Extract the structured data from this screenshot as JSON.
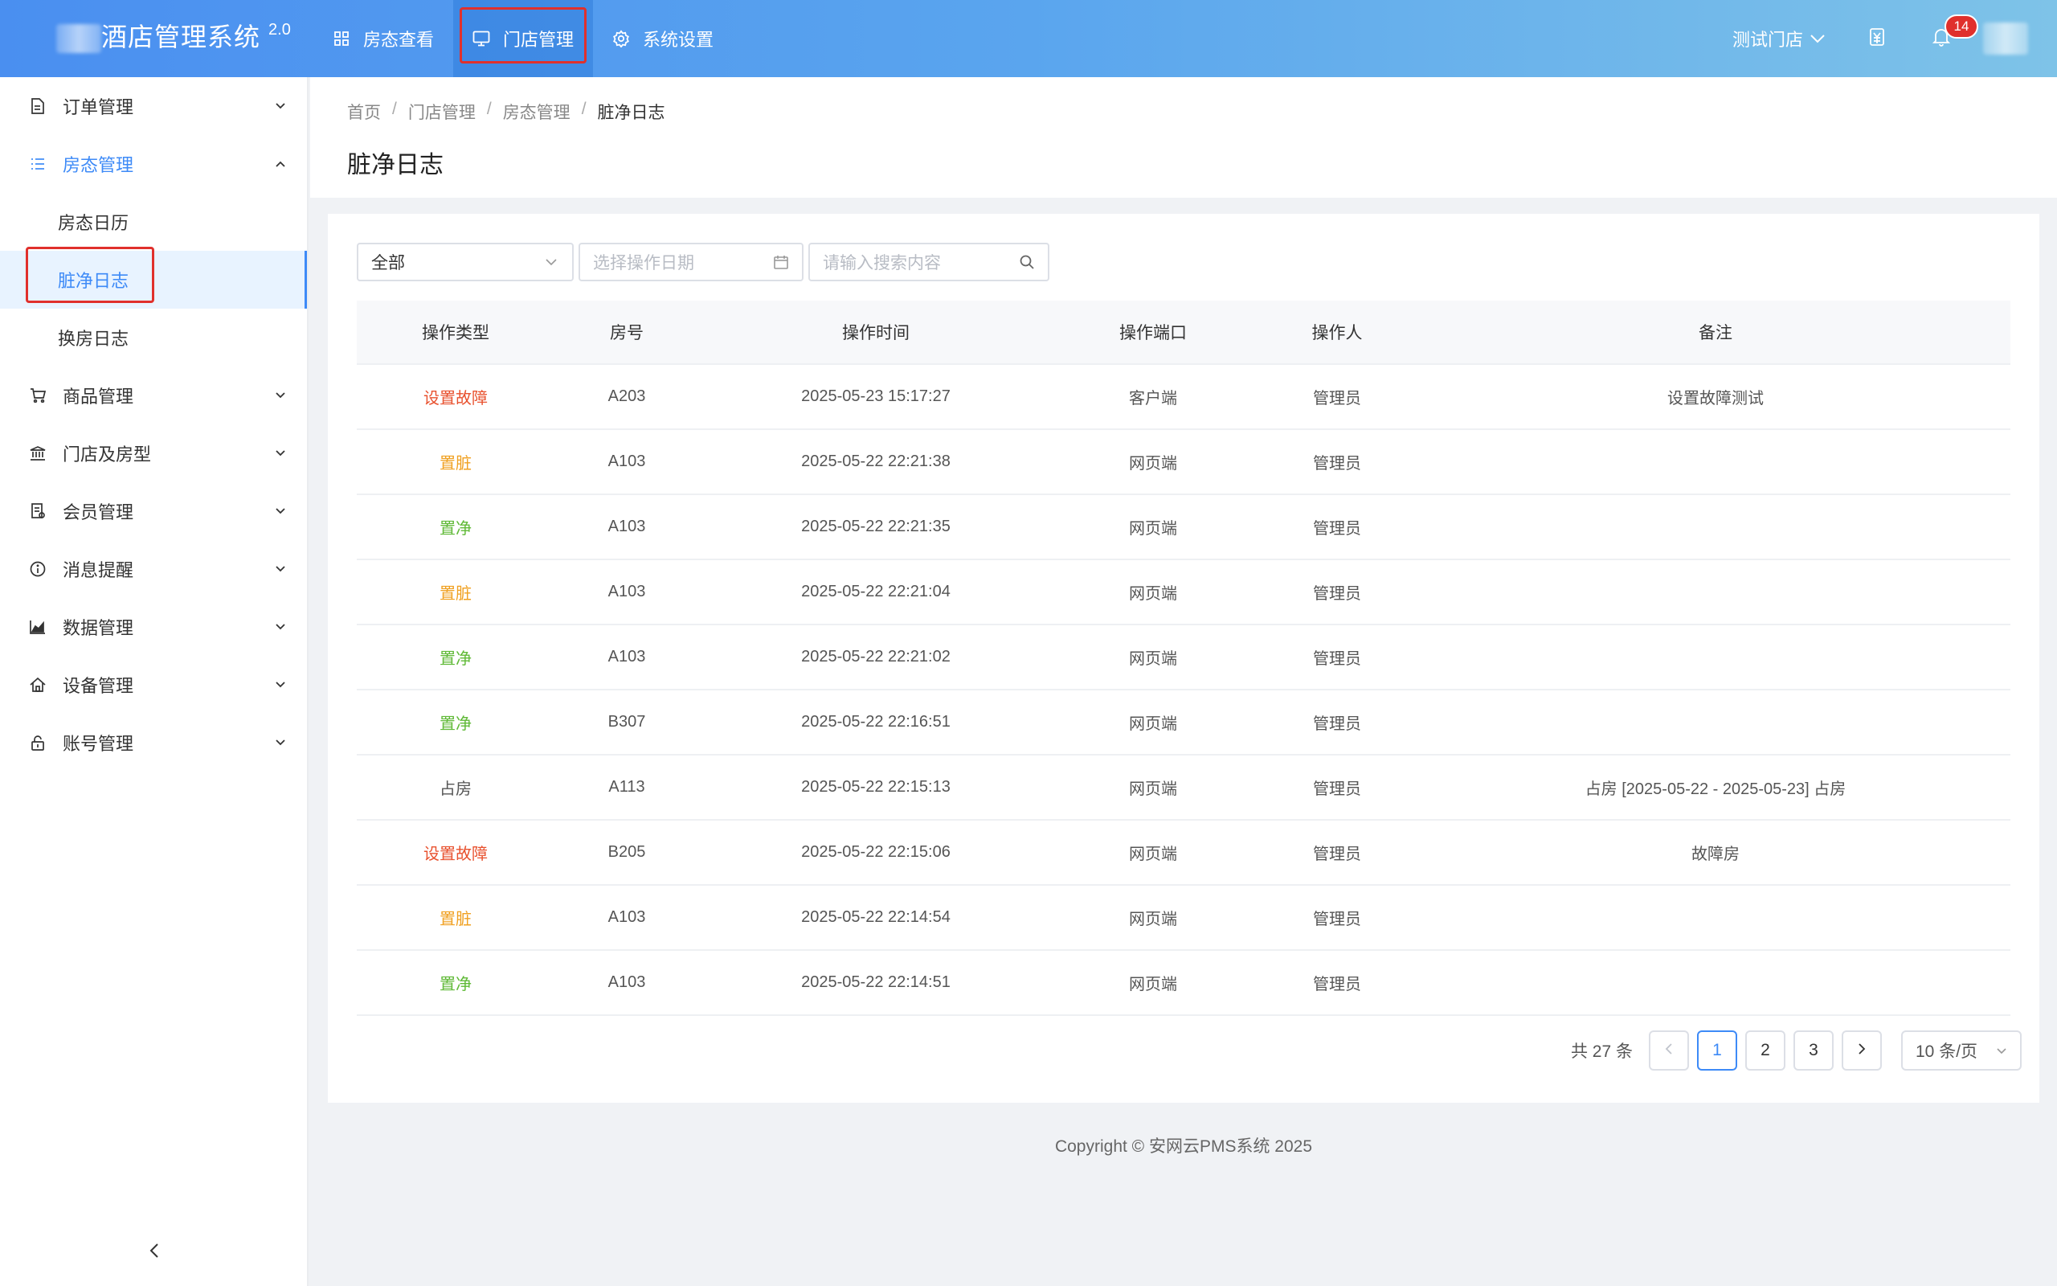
{
  "app": {
    "title": "酒店管理系统",
    "version": "2.0"
  },
  "topnav": [
    {
      "label": "房态查看",
      "icon": "grid-icon"
    },
    {
      "label": "门店管理",
      "icon": "monitor-icon",
      "active": true
    },
    {
      "label": "系统设置",
      "icon": "gear-icon"
    }
  ],
  "header": {
    "store": "测试门店",
    "notifications": "14"
  },
  "sidebar": {
    "items": [
      {
        "label": "订单管理",
        "icon": "document-icon"
      },
      {
        "label": "房态管理",
        "icon": "list-icon",
        "open": true
      },
      {
        "label": "商品管理",
        "icon": "cart-icon"
      },
      {
        "label": "门店及房型",
        "icon": "bank-icon"
      },
      {
        "label": "会员管理",
        "icon": "member-card-icon"
      },
      {
        "label": "消息提醒",
        "icon": "info-icon"
      },
      {
        "label": "数据管理",
        "icon": "area-chart-icon"
      },
      {
        "label": "设备管理",
        "icon": "home-icon"
      },
      {
        "label": "账号管理",
        "icon": "lock-icon"
      }
    ],
    "sub_items": [
      "房态日历",
      "脏净日志",
      "换房日志"
    ]
  },
  "breadcrumb": [
    "首页",
    "门店管理",
    "房态管理",
    "脏净日志"
  ],
  "page_title": "脏净日志",
  "filters": {
    "type_value": "全部",
    "date_placeholder": "选择操作日期",
    "search_placeholder": "请输入搜索内容"
  },
  "table": {
    "headers": [
      "操作类型",
      "房号",
      "操作时间",
      "操作端口",
      "操作人",
      "备注"
    ],
    "rows": [
      {
        "type": "设置故障",
        "room": "A203",
        "time": "2025-05-23 15:17:27",
        "port": "客户端",
        "operator": "管理员",
        "note": "设置故障测试"
      },
      {
        "type": "置脏",
        "room": "A103",
        "time": "2025-05-22 22:21:38",
        "port": "网页端",
        "operator": "管理员",
        "note": ""
      },
      {
        "type": "置净",
        "room": "A103",
        "time": "2025-05-22 22:21:35",
        "port": "网页端",
        "operator": "管理员",
        "note": ""
      },
      {
        "type": "置脏",
        "room": "A103",
        "time": "2025-05-22 22:21:04",
        "port": "网页端",
        "operator": "管理员",
        "note": ""
      },
      {
        "type": "置净",
        "room": "A103",
        "time": "2025-05-22 22:21:02",
        "port": "网页端",
        "operator": "管理员",
        "note": ""
      },
      {
        "type": "置净",
        "room": "B307",
        "time": "2025-05-22 22:16:51",
        "port": "网页端",
        "operator": "管理员",
        "note": ""
      },
      {
        "type": "占房",
        "room": "A113",
        "time": "2025-05-22 22:15:13",
        "port": "网页端",
        "operator": "管理员",
        "note": "占房 [2025-05-22 - 2025-05-23] 占房"
      },
      {
        "type": "设置故障",
        "room": "B205",
        "time": "2025-05-22 22:15:06",
        "port": "网页端",
        "operator": "管理员",
        "note": "故障房"
      },
      {
        "type": "置脏",
        "room": "A103",
        "time": "2025-05-22 22:14:54",
        "port": "网页端",
        "operator": "管理员",
        "note": ""
      },
      {
        "type": "置净",
        "room": "A103",
        "time": "2025-05-22 22:14:51",
        "port": "网页端",
        "operator": "管理员",
        "note": ""
      }
    ]
  },
  "type_colors": {
    "设置故障": "#e8512e",
    "置脏": "#f0a020",
    "置净": "#5fb936",
    "占房": "#555555"
  },
  "pagination": {
    "total_text": "共 27 条",
    "pages": [
      "1",
      "2",
      "3"
    ],
    "current": "1",
    "page_size": "10 条/页"
  },
  "footer": "Copyright © 安网云PMS系统 2025",
  "colors": {
    "accent": "#3d8af7",
    "highlight_box": "#e0302c"
  }
}
